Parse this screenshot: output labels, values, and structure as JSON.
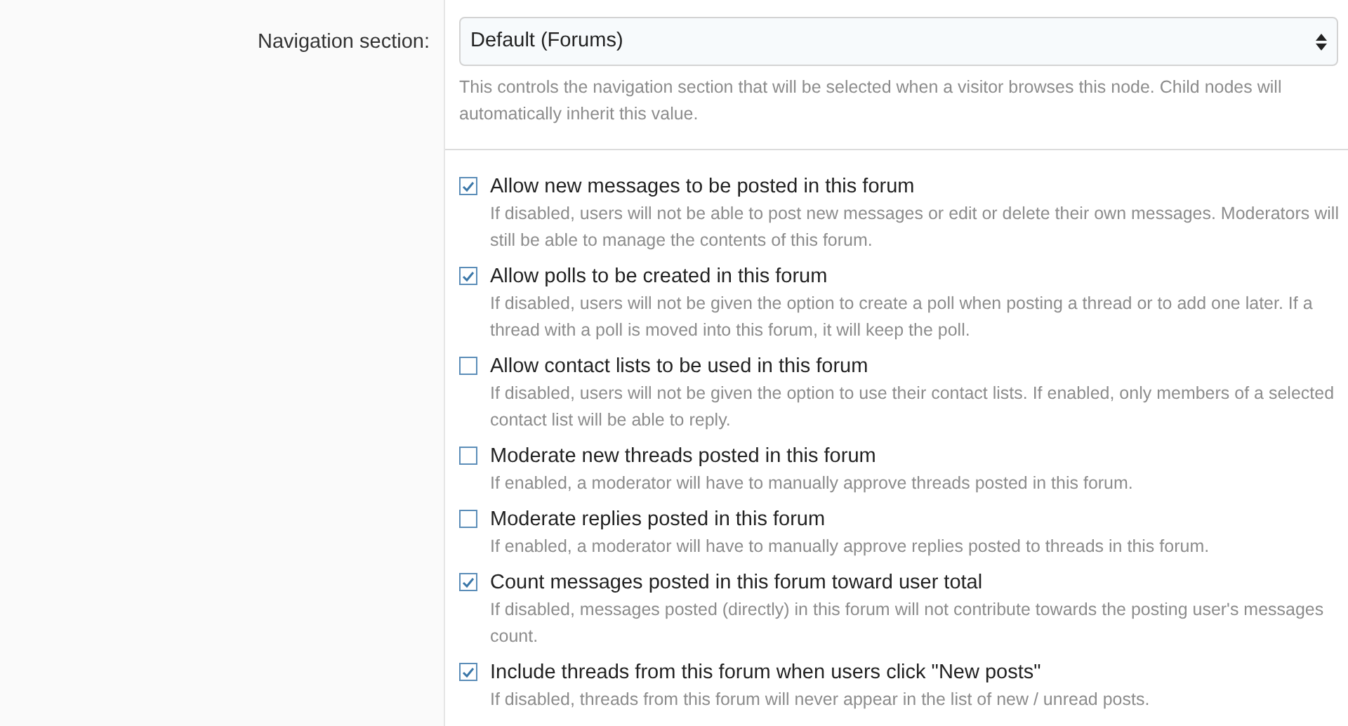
{
  "navigation": {
    "label": "Navigation section:",
    "value": "Default (Forums)",
    "hint": "This controls the navigation section that will be selected when a visitor browses this node. Child nodes will automatically inherit this value."
  },
  "options": [
    {
      "label": "Allow new messages to be posted in this forum",
      "hint": "If disabled, users will not be able to post new messages or edit or delete their own messages. Moderators will still be able to manage the contents of this forum.",
      "checked": true
    },
    {
      "label": "Allow polls to be created in this forum",
      "hint": "If disabled, users will not be given the option to create a poll when posting a thread or to add one later. If a thread with a poll is moved into this forum, it will keep the poll.",
      "checked": true
    },
    {
      "label": "Allow contact lists to be used in this forum",
      "hint": "If disabled, users will not be given the option to use their contact lists. If enabled, only members of a selected contact list will be able to reply.",
      "checked": false
    },
    {
      "label": "Moderate new threads posted in this forum",
      "hint": "If enabled, a moderator will have to manually approve threads posted in this forum.",
      "checked": false
    },
    {
      "label": "Moderate replies posted in this forum",
      "hint": "If enabled, a moderator will have to manually approve replies posted to threads in this forum.",
      "checked": false
    },
    {
      "label": "Count messages posted in this forum toward user total",
      "hint": "If disabled, messages posted (directly) in this forum will not contribute towards the posting user's messages count.",
      "checked": true
    },
    {
      "label": "Include threads from this forum when users click \"New posts\"",
      "hint": "If disabled, threads from this forum will never appear in the list of new / unread posts.",
      "checked": true
    }
  ]
}
